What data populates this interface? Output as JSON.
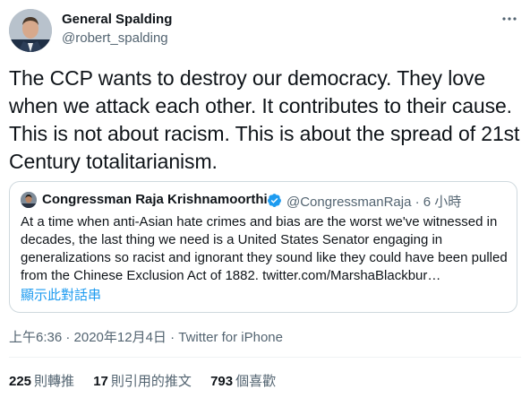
{
  "author": {
    "display_name": "General Spalding",
    "handle": "@robert_spalding"
  },
  "tweet": {
    "text": "The CCP wants to destroy our democracy. They love when we attack each other. It contributes to their cause. This is not about racism. This is about the spread of 21st Century totalitarianism."
  },
  "quoted_tweet": {
    "display_name": "Congressman Raja Krishnamoorthi",
    "verified": true,
    "handle": "@CongressmanRaja",
    "separator": "·",
    "time": "6 小時",
    "text": "At a time when anti-Asian hate crimes and bias are the worst we've witnessed in decades, the last thing we need is a United States Senator engaging in generalizations so racist and ignorant they sound like they could have been pulled from the Chinese Exclusion Act of 1882. twitter.com/MarshaBlackbur…",
    "thread_link": "顯示此對話串"
  },
  "meta": {
    "timestamp": "上午6:36 · 2020年12月4日",
    "separator": "·",
    "source": "Twitter for iPhone"
  },
  "stats": {
    "retweets": {
      "count": "225",
      "label": "則轉推"
    },
    "quotes": {
      "count": "17",
      "label": "則引用的推文"
    },
    "likes": {
      "count": "793",
      "label": "個喜歡"
    }
  },
  "colors": {
    "accent": "#1d9bf0",
    "secondary_text": "#536471",
    "border": "#cfd9de"
  },
  "icons": {
    "more": "more-dots-icon",
    "verified": "verified-badge-icon"
  }
}
